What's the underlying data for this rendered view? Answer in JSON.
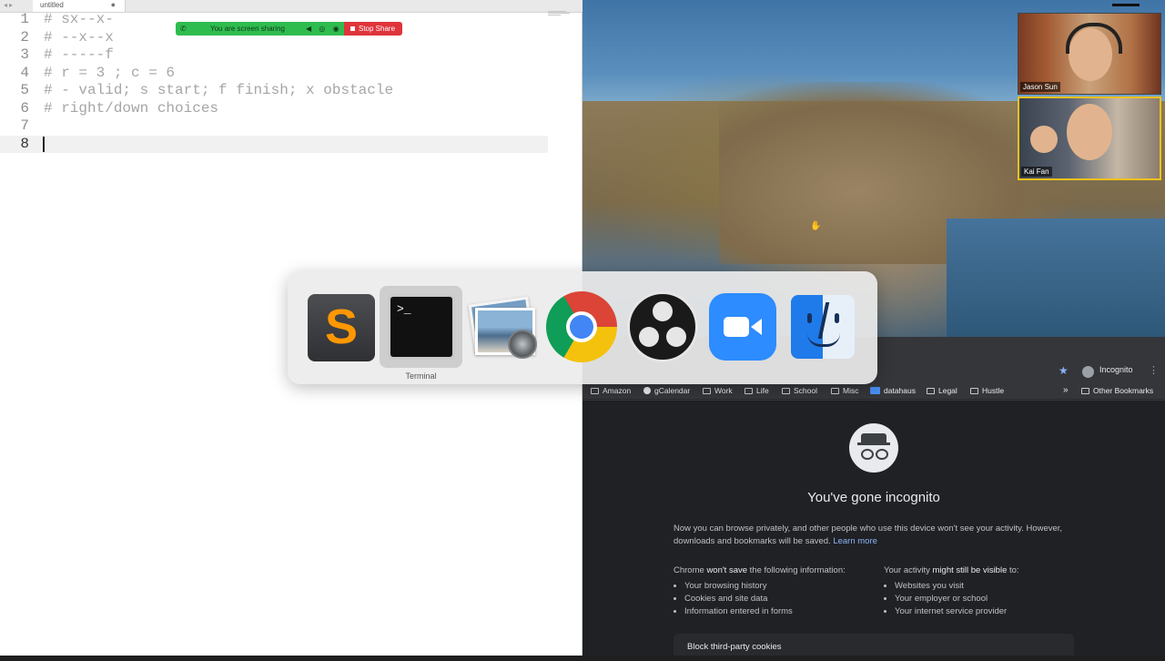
{
  "editor": {
    "tab_name": "untitled",
    "tab_dirty_marker": "●",
    "lines": [
      {
        "num": "1",
        "text": "# sx--x-"
      },
      {
        "num": "2",
        "text": "# --x--x"
      },
      {
        "num": "3",
        "text": "# -----f"
      },
      {
        "num": "4",
        "text": "# r = 3 ; c = 6"
      },
      {
        "num": "5",
        "text": "# - valid; s start; f finish; x obstacle"
      },
      {
        "num": "6",
        "text": "# right/down choices"
      },
      {
        "num": "7",
        "text": ""
      },
      {
        "num": "8",
        "text": ""
      }
    ]
  },
  "share_bar": {
    "status_text": "You are screen sharing",
    "stop_label": "Stop Share",
    "status_color": "#2fbc4f",
    "stop_color": "#e0343b"
  },
  "zoom": {
    "participants": [
      {
        "name": "Jason Sun"
      },
      {
        "name": "Kai Fan"
      }
    ],
    "active_speaker_color": "#f1c21b"
  },
  "app_switcher": {
    "apps": [
      {
        "name": "Sublime Text",
        "icon": "sublime-icon"
      },
      {
        "name": "Terminal",
        "icon": "terminal-icon",
        "selected": true
      },
      {
        "name": "Preview",
        "icon": "preview-icon"
      },
      {
        "name": "Google Chrome",
        "icon": "chrome-icon"
      },
      {
        "name": "OBS",
        "icon": "obs-icon"
      },
      {
        "name": "Zoom",
        "icon": "zoom-icon"
      },
      {
        "name": "Finder",
        "icon": "finder-icon"
      }
    ],
    "selected_label": "Terminal",
    "terminal_prompt": ">_"
  },
  "chrome": {
    "profile_label": "Incognito",
    "bookmarks": [
      {
        "label": "Amazon",
        "icon": "folder-icon"
      },
      {
        "label": "gCalendar",
        "icon": "google-icon"
      },
      {
        "label": "Work",
        "icon": "folder-icon"
      },
      {
        "label": "Life",
        "icon": "folder-icon"
      },
      {
        "label": "School",
        "icon": "folder-icon"
      },
      {
        "label": "Misc",
        "icon": "folder-icon"
      },
      {
        "label": "datahaus",
        "icon": "datahaus-icon"
      },
      {
        "label": "Legal",
        "icon": "folder-icon"
      },
      {
        "label": "Hustle",
        "icon": "folder-icon"
      }
    ],
    "more_bookmarks": "»",
    "other_bookmarks": "Other Bookmarks",
    "incognito": {
      "title": "You've gone incognito",
      "intro_1": "Now you can browse privately, and other people who use this device won't see your activity. However, downloads and bookmarks will be saved.",
      "learn_more": "Learn more",
      "left_heading_pre": "Chrome ",
      "left_heading_bold": "won't save",
      "left_heading_post": " the following information:",
      "left_items": [
        "Your browsing history",
        "Cookies and site data",
        "Information entered in forms"
      ],
      "right_heading_pre": "Your activity ",
      "right_heading_bold": "might still be visible",
      "right_heading_post": " to:",
      "right_items": [
        "Websites you visit",
        "Your employer or school",
        "Your internet service provider"
      ],
      "block_cookies": "Block third-party cookies"
    }
  }
}
